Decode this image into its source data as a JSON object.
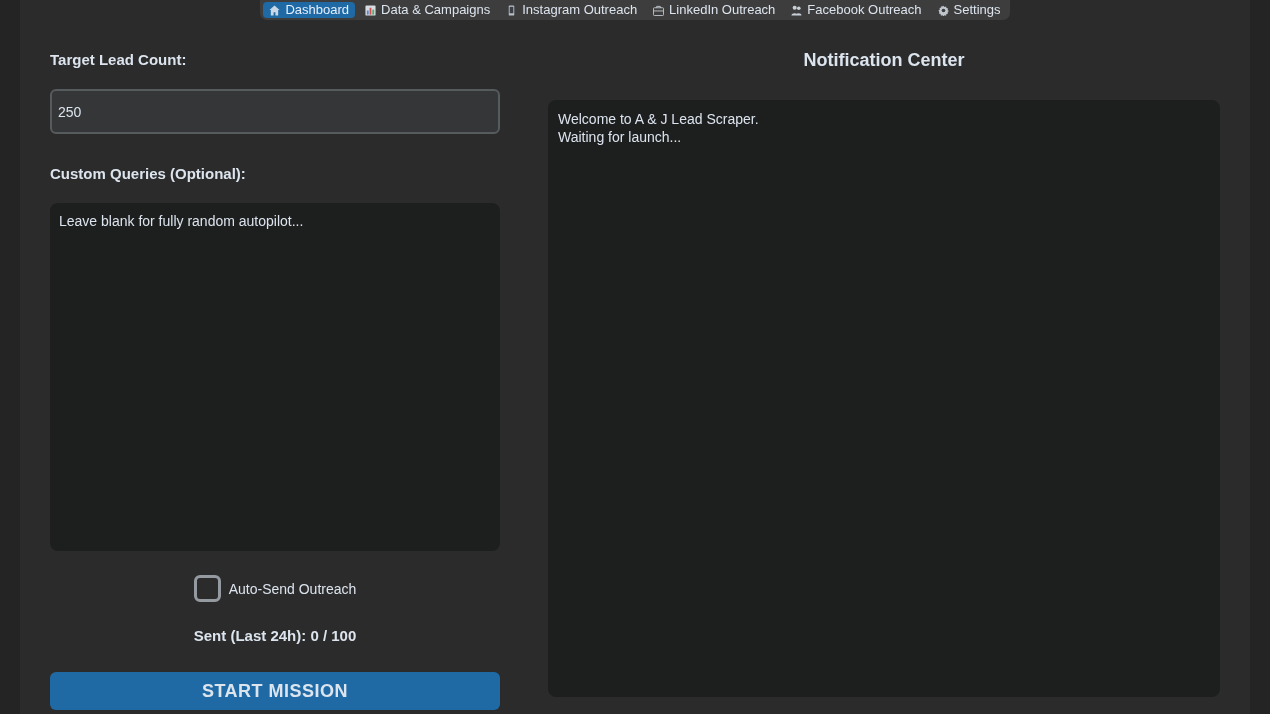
{
  "tabs": [
    {
      "label": "Dashboard",
      "selected": true
    },
    {
      "label": "Data & Campaigns",
      "selected": false
    },
    {
      "label": "Instagram Outreach",
      "selected": false
    },
    {
      "label": "LinkedIn Outreach",
      "selected": false
    },
    {
      "label": "Facebook Outreach",
      "selected": false
    },
    {
      "label": "Settings",
      "selected": false
    }
  ],
  "left_panel": {
    "target_lead_count": {
      "label": "Target Lead Count:",
      "value": "250"
    },
    "custom_queries": {
      "label": "Custom Queries (Optional):",
      "value": "Leave blank for fully random autopilot..."
    },
    "auto_send": {
      "label": "Auto-Send Outreach",
      "checked": false
    },
    "sent_counter": "Sent (Last 24h): 0 / 100",
    "start_button": "START MISSION"
  },
  "notification_center": {
    "title": "Notification Center",
    "lines": [
      "Welcome to A & J Lead Scraper.",
      "Waiting for launch..."
    ]
  }
}
